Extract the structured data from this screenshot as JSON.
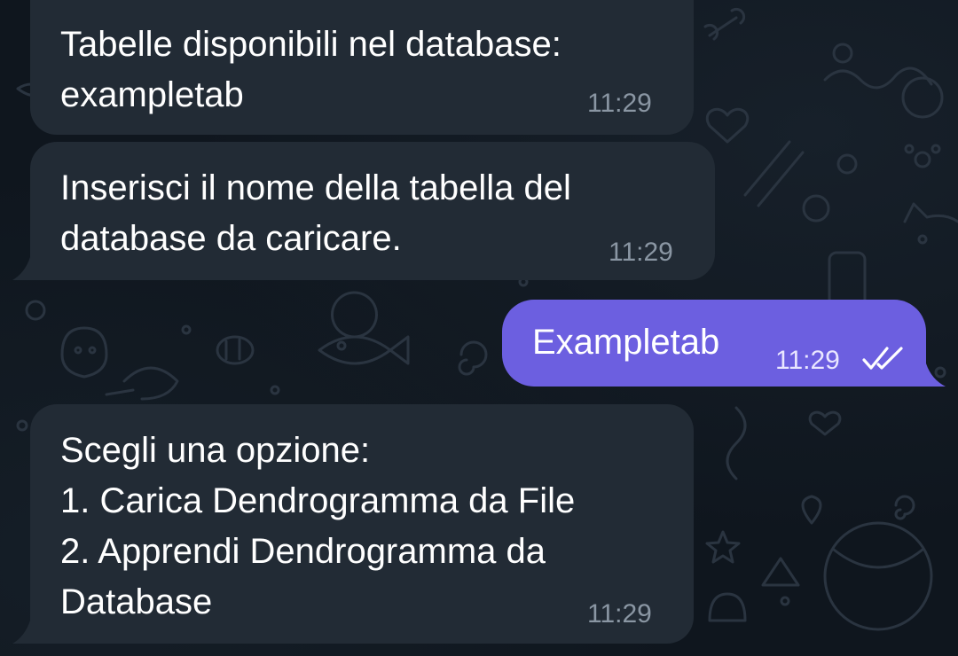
{
  "messages": [
    {
      "id": "m1",
      "direction": "incoming",
      "text": "Tabelle disponibili nel database:\nexampletab",
      "time": "11:29"
    },
    {
      "id": "m2",
      "direction": "incoming",
      "text": "Inserisci il nome della tabella del\ndatabase da caricare.",
      "time": "11:29"
    },
    {
      "id": "m3",
      "direction": "outgoing",
      "text": "Exampletab",
      "time": "11:29",
      "status_icon": "double-check-icon"
    },
    {
      "id": "m4",
      "direction": "incoming",
      "text": "Scegli una opzione:\n1. Carica Dendrogramma da File\n2. Apprendi Dendrogramma da\nDatabase",
      "time": "11:29"
    }
  ],
  "colors": {
    "background": "#0f161e",
    "incoming_bubble": "#222b35",
    "outgoing_bubble": "#6c5fe0",
    "message_text": "#ffffff",
    "incoming_time": "#8a96a3",
    "outgoing_time": "#e9e6ff"
  }
}
